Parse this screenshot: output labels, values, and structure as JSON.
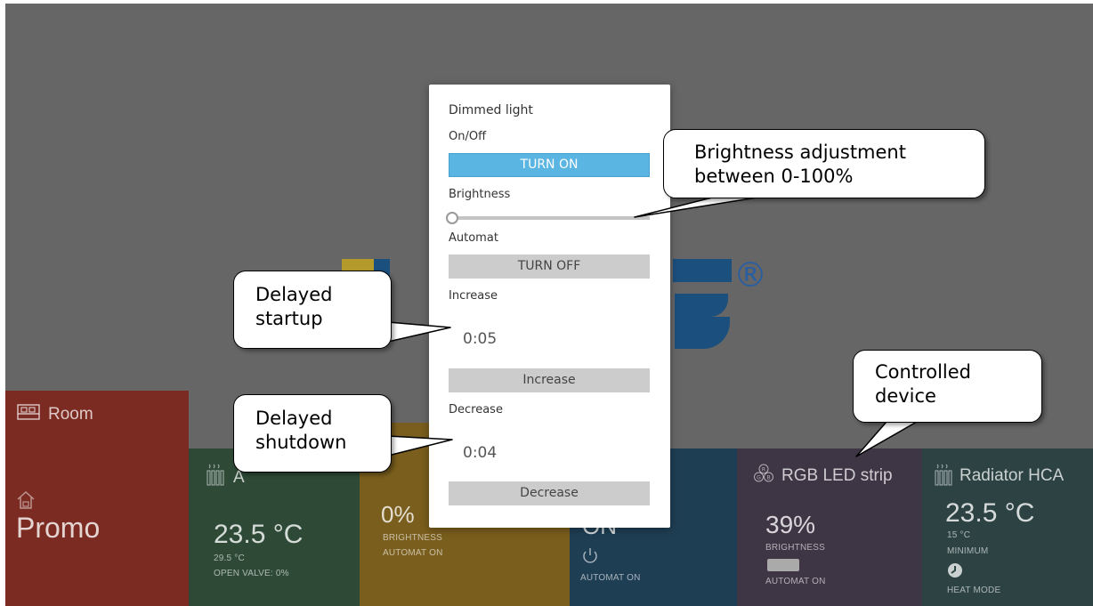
{
  "background": {
    "logo_registered_mark": "®"
  },
  "dialog": {
    "title": "Dimmed light",
    "onoff_label": "On/Off",
    "onoff_button": "TURN ON",
    "brightness_label": "Brightness",
    "brightness_value": 0,
    "automat_label": "Automat",
    "automat_button": "TURN OFF",
    "increase_label": "Increase",
    "increase_time": "0:05",
    "increase_button": "Increase",
    "decrease_label": "Decrease",
    "decrease_time": "0:04",
    "decrease_button": "Decrease"
  },
  "tiles": {
    "room": {
      "title": "Room",
      "value": "Promo",
      "color": "#7b2b22"
    },
    "heating": {
      "title": "A",
      "temp": "23.5 °C",
      "setpoint": "29.5 °C",
      "status": "OPEN VALVE: 0%",
      "color": "#2e4a37"
    },
    "dimmer": {
      "value": "0%",
      "line1": "BRIGHTNESS",
      "line2": "AUTOMAT ON",
      "color": "#7a5e1d"
    },
    "switch": {
      "value": "ON",
      "status": "AUTOMAT ON",
      "color": "#1e3e53"
    },
    "rgb": {
      "title": "RGB LED strip",
      "value": "39%",
      "line1": "BRIGHTNESS",
      "line2": "AUTOMAT ON",
      "color": "#3e3545"
    },
    "radiator": {
      "title": "Radiator HCA",
      "temp": "23.5 °C",
      "setpoint": "15 °C",
      "mode1": "MINIMUM",
      "mode2": "HEAT MODE",
      "color": "#2d4343"
    }
  },
  "callouts": {
    "brightness": [
      "Brightness adjustment",
      "between 0-100%"
    ],
    "startup": [
      "Delayed",
      "startup"
    ],
    "shutdown": [
      "Delayed",
      "shutdown"
    ],
    "device": [
      "Controlled",
      "device"
    ]
  }
}
